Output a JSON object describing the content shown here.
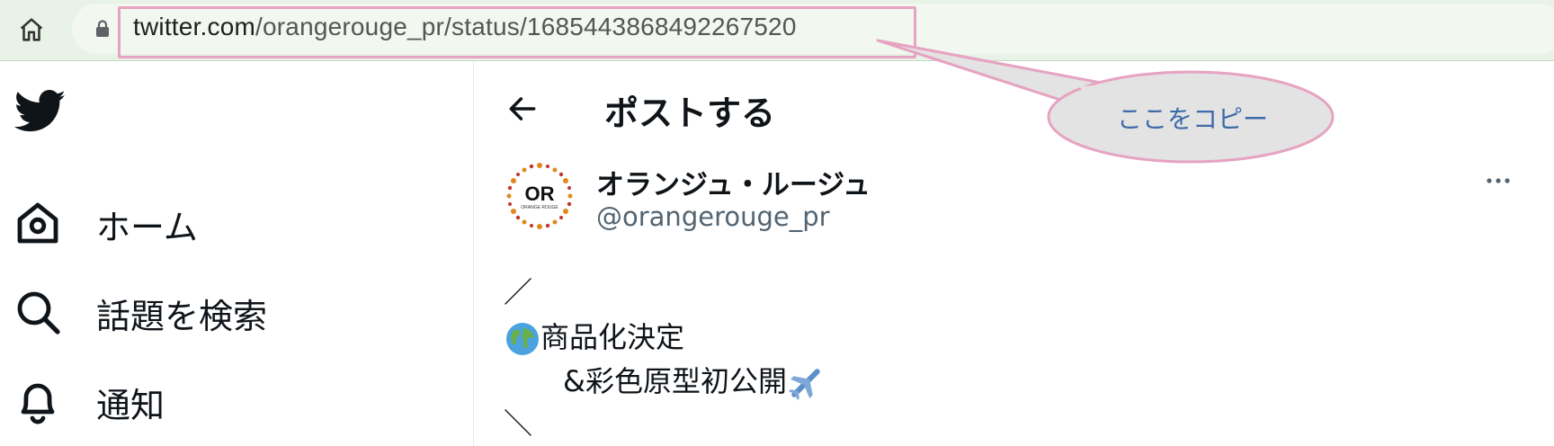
{
  "browser": {
    "url_host": "twitter.com",
    "url_path": "/orangerouge_pr/status/1685443868492267520"
  },
  "annotation": {
    "callout_text": "ここをコピー",
    "callout_color": "#3d6aa8",
    "highlight_color": "#e6a3c2",
    "bubble_fill": "#e3e3e3"
  },
  "sidebar": {
    "items": [
      {
        "label": "ホーム",
        "icon": "home-icon"
      },
      {
        "label": "話題を検索",
        "icon": "search-icon"
      },
      {
        "label": "通知",
        "icon": "bell-icon"
      }
    ]
  },
  "header": {
    "title": "ポストする"
  },
  "post": {
    "display_name": "オランジュ・ルージュ",
    "handle": "@orangerouge_pr",
    "avatar_text": "OR",
    "avatar_subtext": "ORANGE ROUGE",
    "lines": [
      "／",
      "商品化決定",
      "&彩色原型初公開",
      "＼"
    ]
  },
  "colors": {
    "brand_blue": "#1d9bf0",
    "text": "#0f1419",
    "secondary_text": "#536471",
    "browser_bg": "#e8f2e6"
  }
}
